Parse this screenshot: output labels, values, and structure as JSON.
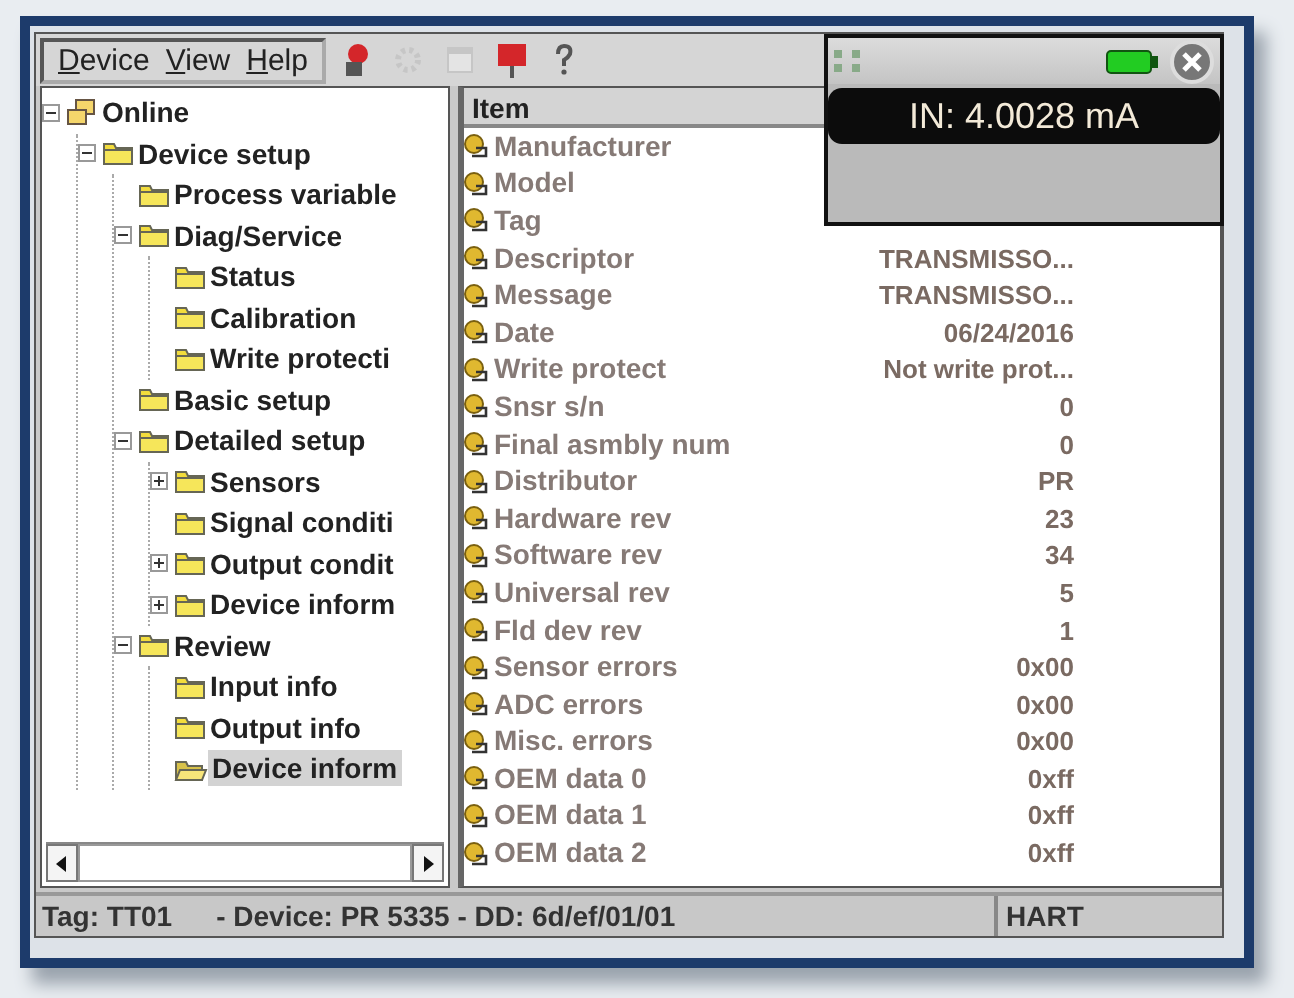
{
  "menu": [
    {
      "label": "Device"
    },
    {
      "label": "View"
    },
    {
      "label": "Help"
    }
  ],
  "toolbar": [
    {
      "kind": "device",
      "disabled": false
    },
    {
      "kind": "gear",
      "disabled": true
    },
    {
      "kind": "window",
      "disabled": true
    },
    {
      "kind": "stop",
      "disabled": false
    },
    {
      "kind": "help",
      "disabled": false
    }
  ],
  "tree": [
    {
      "label": "Online",
      "kind": "network",
      "expanded": true,
      "selected": false,
      "children": [
        {
          "label": "Device setup",
          "kind": "folder",
          "expanded": true,
          "selected": false,
          "children": [
            {
              "label": "Process variable",
              "kind": "folder",
              "selected": false
            },
            {
              "label": "Diag/Service",
              "kind": "folder",
              "expanded": true,
              "selected": false,
              "children": [
                {
                  "label": "Status",
                  "kind": "folder",
                  "selected": false
                },
                {
                  "label": "Calibration",
                  "kind": "folder",
                  "selected": false
                },
                {
                  "label": "Write protecti",
                  "kind": "folder",
                  "selected": false
                }
              ]
            },
            {
              "label": "Basic setup",
              "kind": "folder",
              "selected": false
            },
            {
              "label": "Detailed setup",
              "kind": "folder",
              "expanded": true,
              "selected": false,
              "children": [
                {
                  "label": "Sensors",
                  "kind": "folder",
                  "expanded": false,
                  "selected": false
                },
                {
                  "label": "Signal conditi",
                  "kind": "folder",
                  "selected": false
                },
                {
                  "label": "Output condit",
                  "kind": "folder",
                  "expanded": false,
                  "selected": false
                },
                {
                  "label": "Device inform",
                  "kind": "folder",
                  "expanded": false,
                  "selected": false
                }
              ]
            },
            {
              "label": "Review",
              "kind": "folder",
              "expanded": true,
              "selected": false,
              "children": [
                {
                  "label": "Input info",
                  "kind": "folder",
                  "selected": false
                },
                {
                  "label": "Output info",
                  "kind": "folder",
                  "selected": false
                },
                {
                  "label": "Device inform",
                  "kind": "folder",
                  "selected": true
                }
              ]
            }
          ]
        }
      ]
    }
  ],
  "list": {
    "header": "Item",
    "rows": [
      {
        "name": "Manufacturer"
      },
      {
        "name": "Model"
      },
      {
        "name": "Tag"
      },
      {
        "name": "Descriptor",
        "value": "TRANSMISSO..."
      },
      {
        "name": "Message",
        "value": "TRANSMISSO..."
      },
      {
        "name": "Date",
        "value": "06/24/2016"
      },
      {
        "name": "Write protect",
        "value": "Not write prot..."
      },
      {
        "name": "Snsr s/n",
        "value": "0"
      },
      {
        "name": "Final asmbly num",
        "value": "0"
      },
      {
        "name": "Distributor",
        "value": "PR"
      },
      {
        "name": "Hardware rev",
        "value": "23"
      },
      {
        "name": "Software rev",
        "value": "34"
      },
      {
        "name": "Universal rev",
        "value": "5"
      },
      {
        "name": "Fld dev rev",
        "value": "1"
      },
      {
        "name": "Sensor errors",
        "value": "0x00"
      },
      {
        "name": "ADC errors",
        "value": "0x00"
      },
      {
        "name": "Misc. errors",
        "value": "0x00"
      },
      {
        "name": "OEM data 0",
        "value": "0xff"
      },
      {
        "name": "OEM data 1",
        "value": "0xff"
      },
      {
        "name": "OEM data 2",
        "value": "0xff"
      }
    ]
  },
  "popup": {
    "reading": "IN: 4.0028 mA"
  },
  "status_bar": {
    "tag": "Tag: TT01",
    "device": "- Device: PR 5335 - DD: 6d/ef/01/01",
    "protocol": "HART"
  }
}
